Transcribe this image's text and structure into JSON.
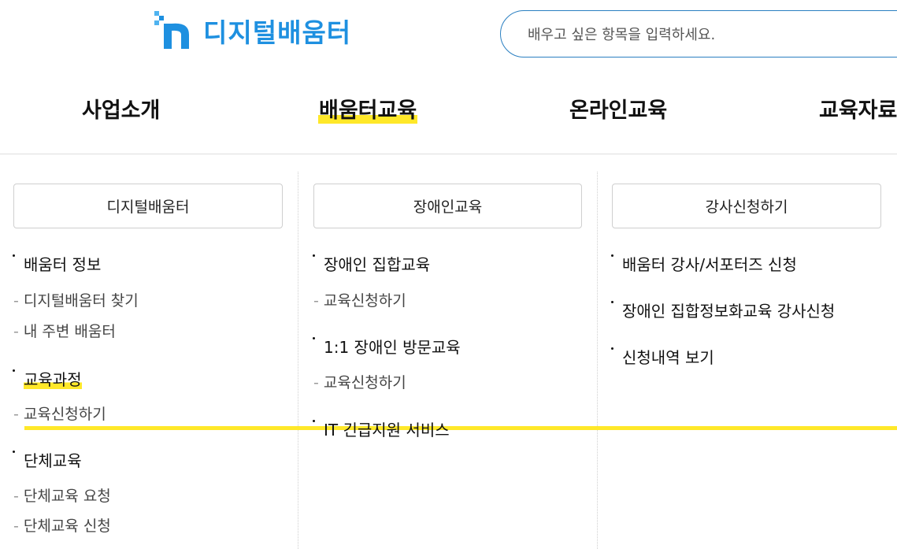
{
  "header": {
    "logo_text": "디지털배움터",
    "search_placeholder": "배우고 싶은 항목을 입력하세요."
  },
  "nav": {
    "items": [
      "사업소개",
      "배움터교육",
      "온라인교육",
      "교육자료"
    ],
    "active_index": 1
  },
  "colors": {
    "brand": "#1e90e0",
    "highlight": "#ffe829",
    "search_border": "#2a7fc1"
  },
  "columns": [
    {
      "title": "디지털배움터",
      "sections": [
        {
          "label": "배움터 정보",
          "subs": [
            "디지털배움터 찾기",
            "내 주변 배움터"
          ]
        },
        {
          "label": "교육과정",
          "subs": [
            "교육신청하기"
          ]
        },
        {
          "label": "단체교육",
          "subs": [
            "단체교육 요청",
            "단체교육 신청"
          ]
        }
      ]
    },
    {
      "title": "장애인교육",
      "sections": [
        {
          "label": "장애인 집합교육",
          "subs": [
            "교육신청하기"
          ]
        },
        {
          "label": "1:1 장애인 방문교육",
          "subs": [
            "교육신청하기"
          ]
        },
        {
          "label": "IT 긴급지원 서비스",
          "subs": []
        }
      ]
    },
    {
      "title": "강사신청하기",
      "sections": [
        {
          "label": "배움터 강사/서포터즈 신청",
          "subs": []
        },
        {
          "label": "장애인 집합정보화교육 강사신청",
          "subs": []
        },
        {
          "label": "신청내역 보기",
          "subs": []
        }
      ]
    }
  ]
}
